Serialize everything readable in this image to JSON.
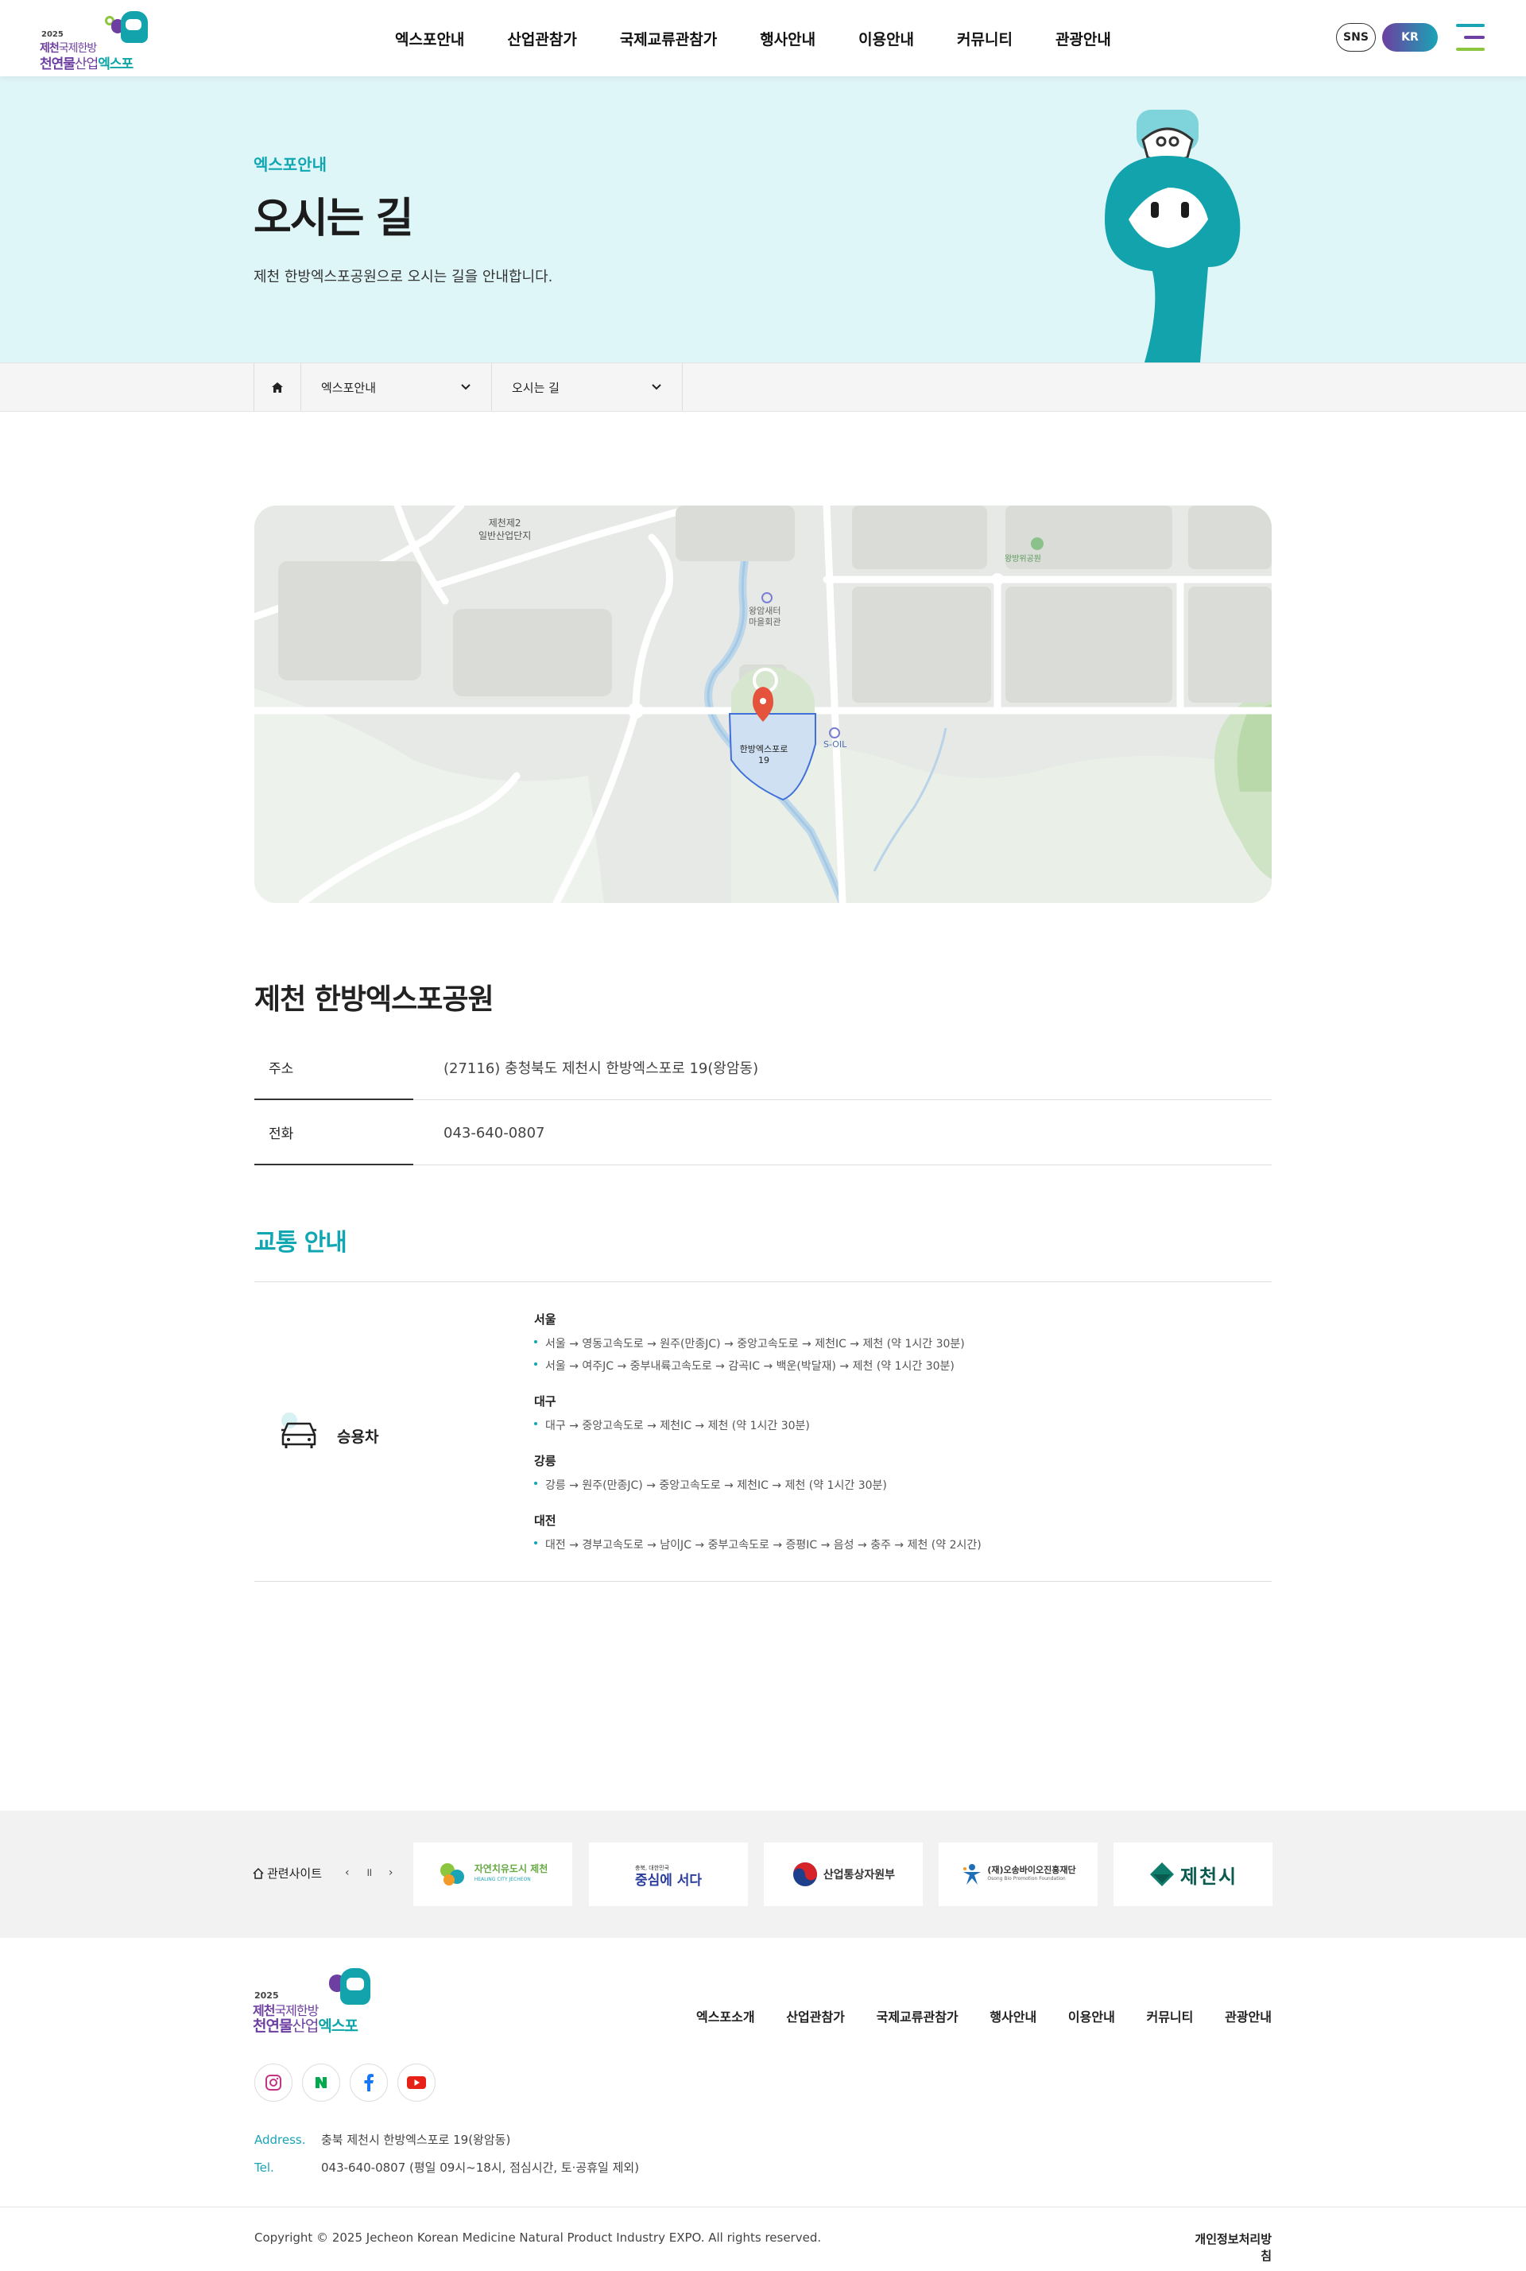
{
  "header": {
    "logo": {
      "year": "2025",
      "line1a": "제천",
      "line1b": "국제한방",
      "line2a": "천연물",
      "line2b": "산업",
      "line2c": "엑스포"
    },
    "nav": [
      "엑스포안내",
      "산업관참가",
      "국제교류관참가",
      "행사안내",
      "이용안내",
      "커뮤니티",
      "관광안내"
    ],
    "sns_label": "SNS",
    "lang_label": "KR",
    "menu_icon": "hamburger-icon"
  },
  "visual": {
    "eyebrow": "엑스포안내",
    "title": "오시는 길",
    "description": "제천 한방엑스포공원으로 오시는 길을 안내합니다.",
    "bg_color": "#dff6f8",
    "accent": "#11a7b2"
  },
  "breadcrumb": {
    "home_icon": "home-icon",
    "depth1": "엑스포안내",
    "depth2": "오시는 길"
  },
  "map": {
    "labels": {
      "industrial": [
        "제천제2",
        "일반산업단지"
      ],
      "center": [
        "왕암새터",
        "마을회관"
      ],
      "park": "왕방위공원",
      "station": "S-OIL",
      "marker": [
        "한방엑스포로",
        "19"
      ]
    }
  },
  "location": {
    "title": "제천 한방엑스포공원",
    "rows": [
      {
        "label": "주소",
        "value": "(27116) 충청북도 제천시 한방엑스포로 19(왕암동)"
      },
      {
        "label": "전화",
        "value": "043-640-0807"
      }
    ]
  },
  "traffic": {
    "title": "교통 안내",
    "mode": "승용차",
    "mode_icon": "car-icon",
    "groups": [
      {
        "region": "서울",
        "routes": [
          "서울 → 영동고속도로 → 원주(만종JC) → 중앙고속도로 → 제천IC → 제천 (약 1시간 30분)",
          "서울 → 여주JC → 중부내륙고속도로 → 감곡IC → 백운(박달재) → 제천 (약 1시간 30분)"
        ]
      },
      {
        "region": "대구",
        "routes": [
          "대구 → 중앙고속도로 → 제천IC → 제천 (약 1시간 30분)"
        ]
      },
      {
        "region": "강릉",
        "routes": [
          "강릉 → 원주(만종JC) → 중앙고속도로 → 제천IC → 제천 (약 1시간 30분)"
        ]
      },
      {
        "region": "대전",
        "routes": [
          "대전 → 경부고속도로 → 남이JC → 중부고속도로 → 증평IC → 음성 → 충주 → 제천 (약 2시간)"
        ]
      }
    ]
  },
  "related": {
    "label": "관련사이트",
    "controls": "‹ ॥ ›",
    "banners": [
      {
        "text": "자연치유도시 제천",
        "sub": "HEALING CITY JECHEON"
      },
      {
        "text": "중심에 서다",
        "sub": "충북, 대한민국"
      },
      {
        "text": "산업통상자원부"
      },
      {
        "text": "(재)오송바이오진흥재단",
        "sub": "Osong Bio Promotion Foundation"
      },
      {
        "text": "제천시"
      }
    ]
  },
  "footer": {
    "nav": [
      "엑스포소개",
      "산업관참가",
      "국제교류관참가",
      "행사안내",
      "이용안내",
      "커뮤니티",
      "관광안내"
    ],
    "social": [
      "instagram-icon",
      "naver-icon",
      "facebook-icon",
      "youtube-icon"
    ],
    "address_label": "Address.",
    "address": "충북 제천시 한방엑스포로 19(왕암동)",
    "tel_label": "Tel.",
    "tel": "043-640-0807 (평일 09시~18시, 점심시간, 토·공휴일 제외)",
    "copyright": "Copyright © 2025 Jecheon Korean Medicine Natural Product Industry EXPO. All rights reserved.",
    "privacy": "개인정보처리방침"
  }
}
